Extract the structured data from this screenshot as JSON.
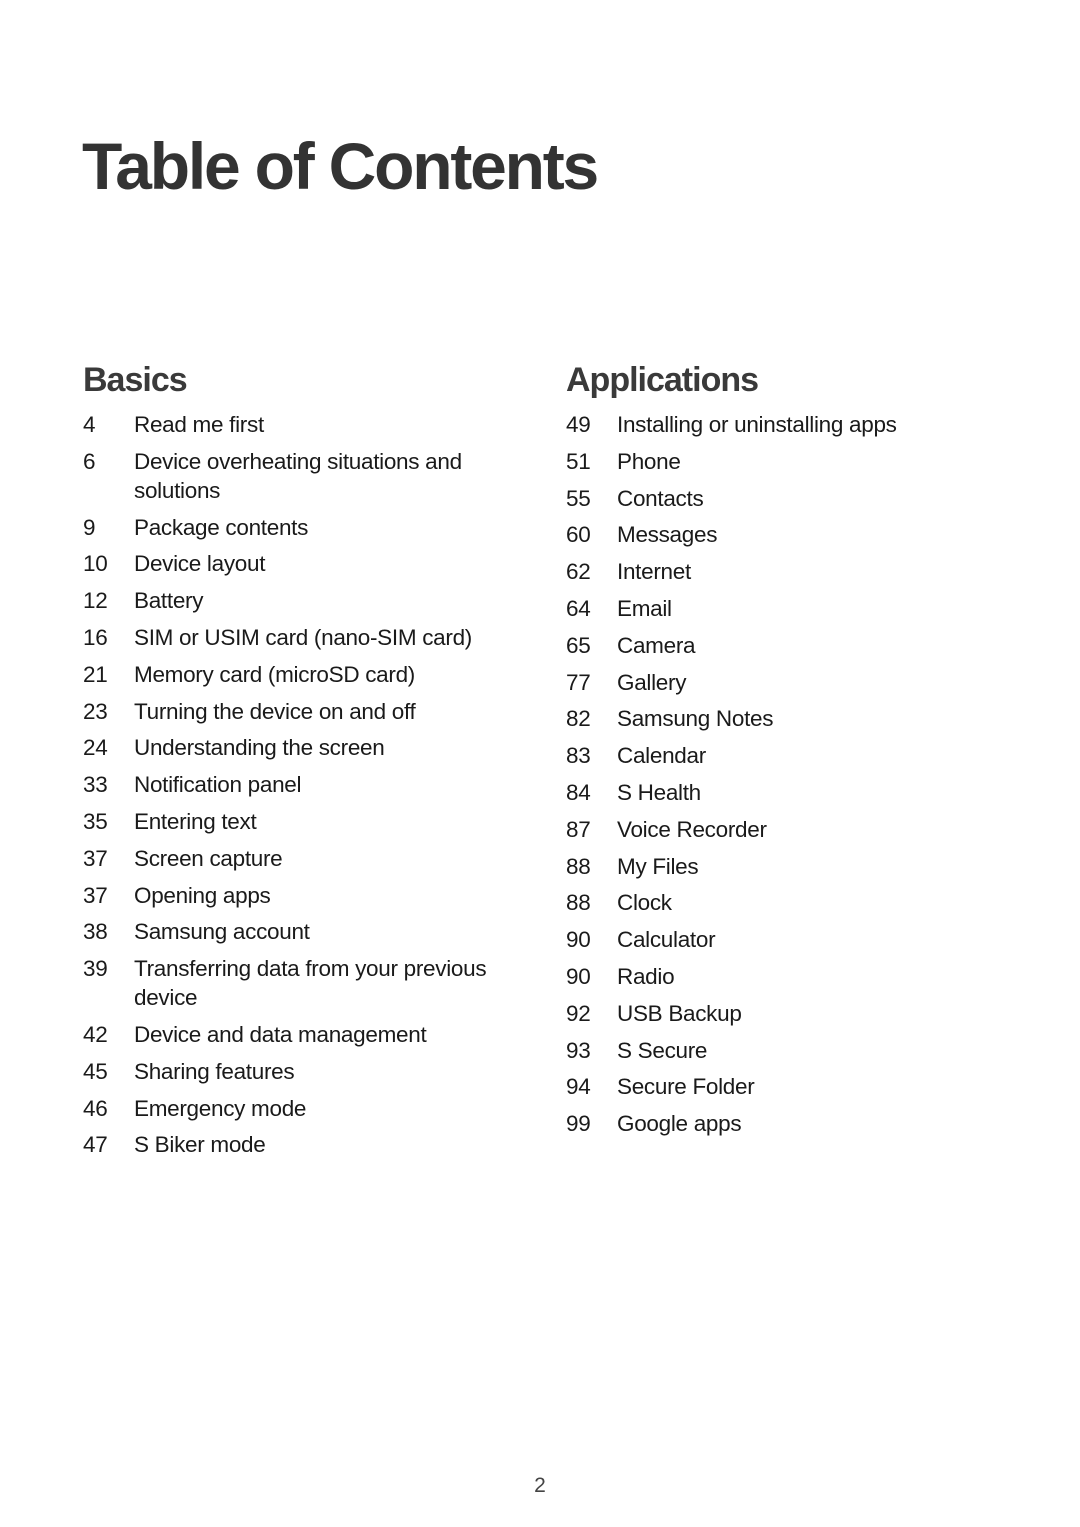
{
  "page": {
    "title": "Table of Contents",
    "page_number": "2"
  },
  "sections": [
    {
      "heading": "Basics",
      "items": [
        {
          "page": "4",
          "label": "Read me first"
        },
        {
          "page": "6",
          "label": "Device overheating situations and solutions"
        },
        {
          "page": "9",
          "label": "Package contents"
        },
        {
          "page": "10",
          "label": "Device layout"
        },
        {
          "page": "12",
          "label": "Battery"
        },
        {
          "page": "16",
          "label": "SIM or USIM card (nano-SIM card)"
        },
        {
          "page": "21",
          "label": "Memory card (microSD card)"
        },
        {
          "page": "23",
          "label": "Turning the device on and off"
        },
        {
          "page": "24",
          "label": "Understanding the screen"
        },
        {
          "page": "33",
          "label": "Notification panel"
        },
        {
          "page": "35",
          "label": "Entering text"
        },
        {
          "page": "37",
          "label": "Screen capture"
        },
        {
          "page": "37",
          "label": "Opening apps"
        },
        {
          "page": "38",
          "label": "Samsung account"
        },
        {
          "page": "39",
          "label": "Transferring data from your previous device"
        },
        {
          "page": "42",
          "label": "Device and data management"
        },
        {
          "page": "45",
          "label": "Sharing features"
        },
        {
          "page": "46",
          "label": "Emergency mode"
        },
        {
          "page": "47",
          "label": "S Biker mode"
        }
      ]
    },
    {
      "heading": "Applications",
      "items": [
        {
          "page": "49",
          "label": "Installing or uninstalling apps"
        },
        {
          "page": "51",
          "label": "Phone"
        },
        {
          "page": "55",
          "label": "Contacts"
        },
        {
          "page": "60",
          "label": "Messages"
        },
        {
          "page": "62",
          "label": "Internet"
        },
        {
          "page": "64",
          "label": "Email"
        },
        {
          "page": "65",
          "label": "Camera"
        },
        {
          "page": "77",
          "label": "Gallery"
        },
        {
          "page": "82",
          "label": "Samsung Notes"
        },
        {
          "page": "83",
          "label": "Calendar"
        },
        {
          "page": "84",
          "label": "S Health"
        },
        {
          "page": "87",
          "label": "Voice Recorder"
        },
        {
          "page": "88",
          "label": "My Files"
        },
        {
          "page": "88",
          "label": "Clock"
        },
        {
          "page": "90",
          "label": "Calculator"
        },
        {
          "page": "90",
          "label": "Radio"
        },
        {
          "page": "92",
          "label": "USB Backup"
        },
        {
          "page": "93",
          "label": "S Secure"
        },
        {
          "page": "94",
          "label": "Secure Folder"
        },
        {
          "page": "99",
          "label": "Google apps"
        }
      ]
    }
  ]
}
